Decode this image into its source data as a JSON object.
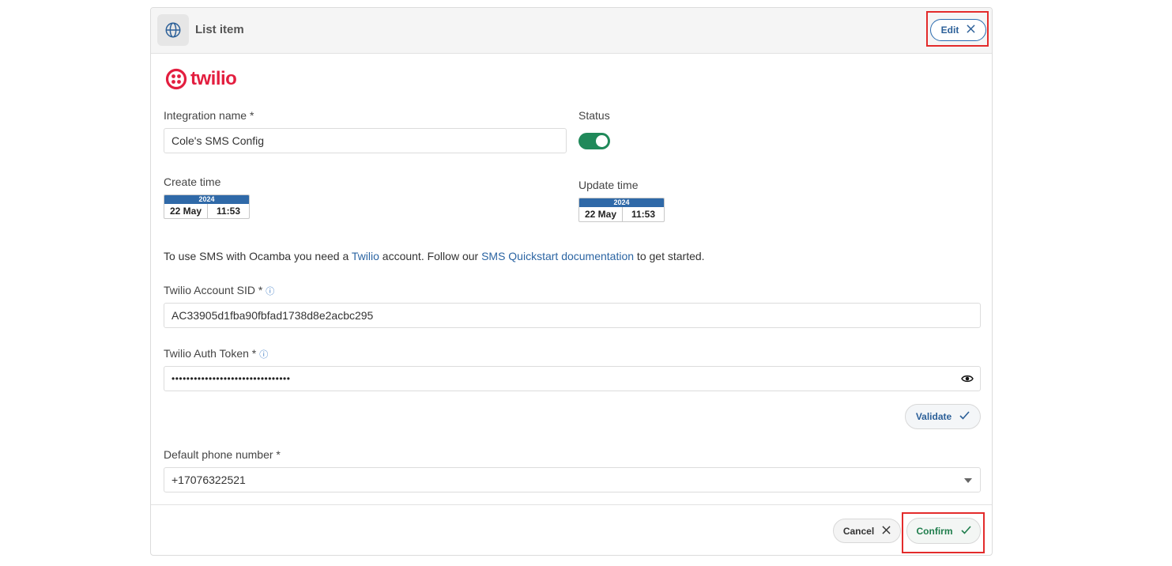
{
  "header": {
    "title": "List item",
    "edit_label": "Edit",
    "icon": "globe-icon"
  },
  "logo": {
    "text": "twilio",
    "color": "#e31e3f"
  },
  "form": {
    "integration_name_label": "Integration name *",
    "integration_name_value": "Cole's SMS Config",
    "status_label": "Status",
    "status_on": true,
    "create_time_label": "Create time",
    "create_time": {
      "year": "2024",
      "day": "22 May",
      "time": "11:53"
    },
    "update_time_label": "Update time",
    "update_time": {
      "year": "2024",
      "day": "22 May",
      "time": "11:53"
    },
    "help": {
      "prefix": "To use SMS with Ocamba you need a ",
      "link1": "Twilio",
      "middle": " account. Follow our ",
      "link2": "SMS Quickstart documentation",
      "suffix": " to get started."
    },
    "account_sid_label": "Twilio Account SID *",
    "account_sid_value": "AC33905d1fba90fbfad1738d8e2acbc295",
    "auth_token_label": "Twilio Auth Token *",
    "auth_token_masked": "••••••••••••••••••••••••••••••••",
    "validate_label": "Validate",
    "phone_label": "Default phone number *",
    "phone_value": "+17076322521"
  },
  "footer": {
    "cancel_label": "Cancel",
    "confirm_label": "Confirm"
  },
  "colors": {
    "accent_blue": "#2b5f98",
    "toggle_green": "#20895a",
    "confirm_green": "#1f7d4c",
    "highlight_red": "#e32b2b"
  }
}
